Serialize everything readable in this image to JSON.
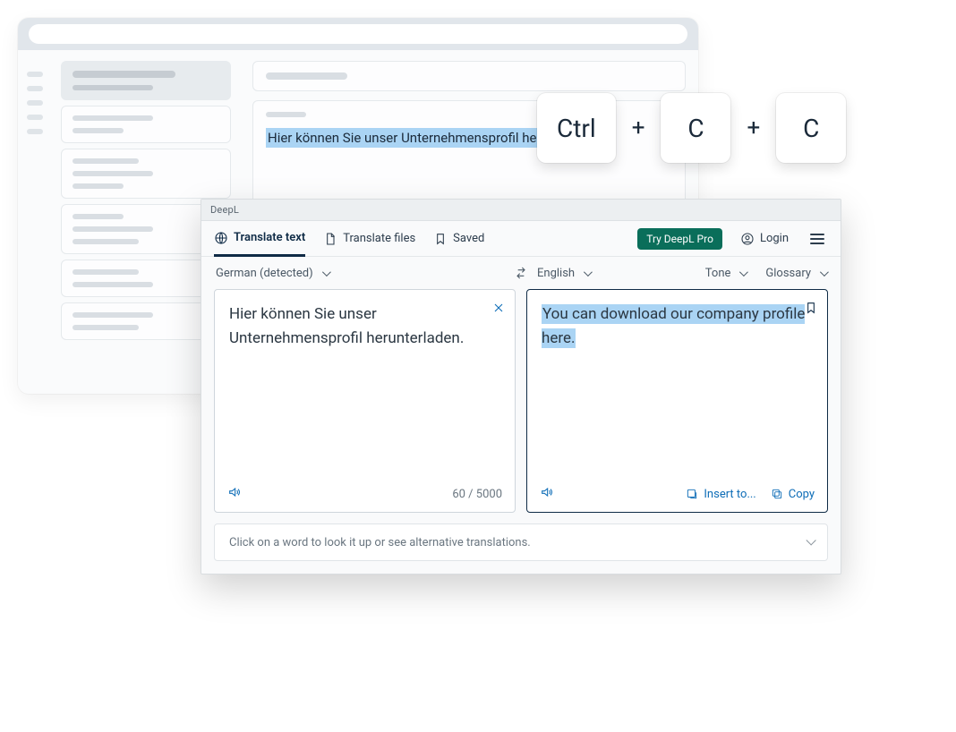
{
  "background": {
    "highlighted_text": "Hier können Sie unser Unternehmensprofil herunterladen"
  },
  "shortcut": {
    "keys": [
      "Ctrl",
      "C",
      "C"
    ],
    "separator": "+"
  },
  "deepl": {
    "window_title": "DeepL",
    "tabs": {
      "translate_text": "Translate text",
      "translate_files": "Translate files",
      "saved": "Saved"
    },
    "header": {
      "try_pro": "Try DeepL Pro",
      "login": "Login"
    },
    "languages": {
      "source": "German (detected)",
      "target": "English",
      "tone": "Tone",
      "glossary": "Glossary"
    },
    "source_text": "Hier können Sie unser Unternehmensprofil herunterladen.",
    "target_text": "You can download our company profile here.",
    "char_count": "60 / 5000",
    "actions": {
      "insert_to": "Insert to...",
      "copy": "Copy"
    },
    "dictionary_hint": "Click on a word to look it up or see alternative translations."
  }
}
